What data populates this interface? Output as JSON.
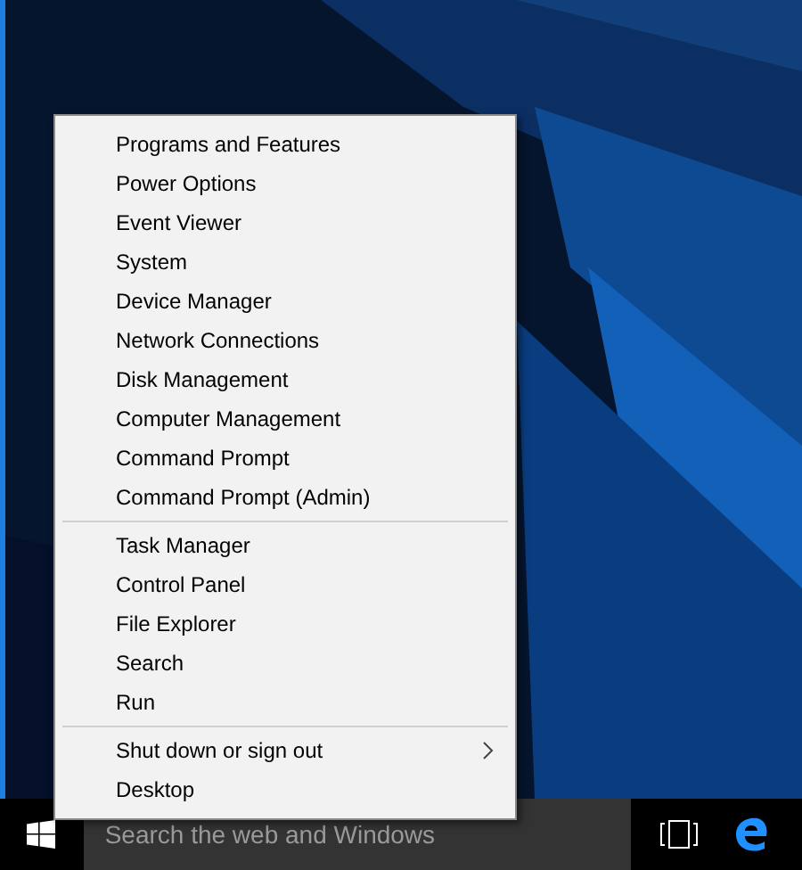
{
  "menu": {
    "groups": [
      {
        "items": [
          {
            "label": "Programs and Features"
          },
          {
            "label": "Power Options"
          },
          {
            "label": "Event Viewer"
          },
          {
            "label": "System"
          },
          {
            "label": "Device Manager"
          },
          {
            "label": "Network Connections"
          },
          {
            "label": "Disk Management"
          },
          {
            "label": "Computer Management"
          },
          {
            "label": "Command Prompt"
          },
          {
            "label": "Command Prompt (Admin)"
          }
        ]
      },
      {
        "items": [
          {
            "label": "Task Manager"
          },
          {
            "label": "Control Panel"
          },
          {
            "label": "File Explorer"
          },
          {
            "label": "Search"
          },
          {
            "label": "Run"
          }
        ]
      },
      {
        "items": [
          {
            "label": "Shut down or sign out",
            "submenu": true
          },
          {
            "label": "Desktop"
          }
        ]
      }
    ]
  },
  "taskbar": {
    "search": {
      "placeholder": "Search the web and Windows"
    }
  }
}
